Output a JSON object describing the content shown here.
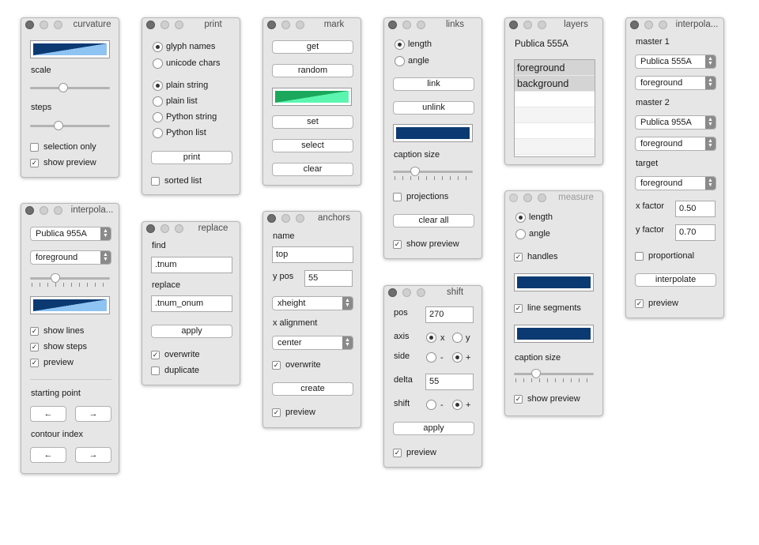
{
  "panels": {
    "curvature": {
      "title": "curvature",
      "scale_label": "scale",
      "steps_label": "steps",
      "selection_only": "selection only",
      "show_preview": "show preview",
      "scale_value": 0.4,
      "steps_value": 0.35
    },
    "print": {
      "title": "print",
      "glyph_names": "glyph names",
      "unicode_chars": "unicode chars",
      "plain_string": "plain string",
      "plain_list": "plain list",
      "python_string": "Python string",
      "python_list": "Python list",
      "print_button": "print",
      "sorted_list": "sorted list"
    },
    "mark": {
      "title": "mark",
      "get": "get",
      "random": "random",
      "set": "set",
      "select": "select",
      "clear": "clear"
    },
    "links": {
      "title": "links",
      "length": "length",
      "angle": "angle",
      "link": "link",
      "unlink": "unlink",
      "caption_size": "caption size",
      "projections": "projections",
      "clear_all": "clear all",
      "show_preview": "show preview"
    },
    "layers": {
      "title": "layers",
      "font": "Publica 555A",
      "rows": [
        "foreground",
        "background",
        "",
        "",
        "",
        ""
      ]
    },
    "interpolate_right": {
      "title": "interpola...",
      "master1": "master 1",
      "master1_font": "Publica 555A",
      "master1_layer": "foreground",
      "master2": "master 2",
      "master2_font": "Publica 955A",
      "master2_layer": "foreground",
      "target": "target",
      "target_layer": "foreground",
      "x_factor_label": "x factor",
      "x_factor": "0.50",
      "y_factor_label": "y factor",
      "y_factor": "0.70",
      "proportional": "proportional",
      "interpolate_button": "interpolate",
      "preview": "preview"
    },
    "interpolate_left": {
      "title": "interpola...",
      "font": "Publica 955A",
      "layer": "foreground",
      "show_lines": "show lines",
      "show_steps": "show steps",
      "preview": "preview",
      "starting_point": "starting point",
      "contour_index": "contour index",
      "prev": "←",
      "next": "→",
      "slider_value": 0.3
    },
    "replace": {
      "title": "replace",
      "find_label": "find",
      "find_value": ".tnum",
      "replace_label": "replace",
      "replace_value": ".tnum_onum",
      "apply": "apply",
      "overwrite": "overwrite",
      "duplicate": "duplicate"
    },
    "anchors": {
      "title": "anchors",
      "name_label": "name",
      "name_value": "top",
      "ypos_label": "y pos",
      "ypos_value": "55",
      "ypos_select": "xheight",
      "x_alignment": "x alignment",
      "x_alignment_value": "center",
      "overwrite": "overwrite",
      "create": "create",
      "preview": "preview"
    },
    "shift": {
      "title": "shift",
      "pos_label": "pos",
      "pos_value": "270",
      "axis_label": "axis",
      "axis_x": "x",
      "axis_y": "y",
      "side_label": "side",
      "side_minus": "-",
      "side_plus": "+",
      "delta_label": "delta",
      "delta_value": "55",
      "shift_label": "shift",
      "shift_minus": "-",
      "shift_plus": "+",
      "apply": "apply",
      "preview": "preview"
    },
    "measure": {
      "title": "measure",
      "length": "length",
      "angle": "angle",
      "handles": "handles",
      "line_segments": "line segments",
      "caption_size": "caption size",
      "show_preview": "show preview"
    }
  },
  "colors": {
    "navy": "#0b3a73",
    "light_blue": "#8fc3f2",
    "green_dark": "#1ba85c",
    "green_light": "#5cf5b0"
  }
}
